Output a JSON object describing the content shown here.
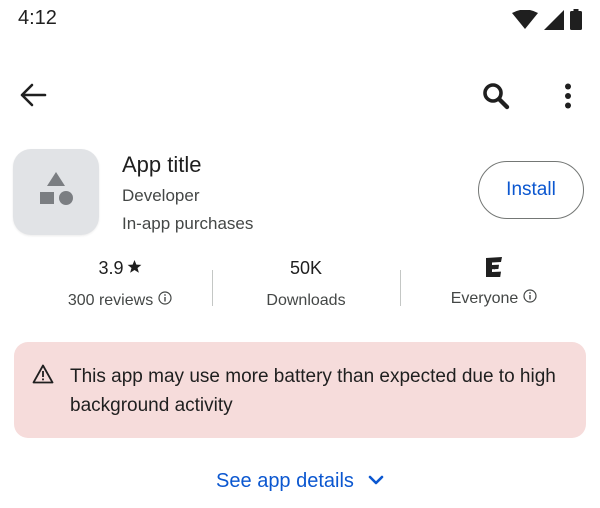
{
  "status_bar": {
    "time": "4:12",
    "icons": [
      "wifi-icon",
      "cellular-signal-icon",
      "battery-icon"
    ]
  },
  "toolbar": {
    "icons": [
      "back-arrow-icon",
      "search-icon",
      "more-vertical-icon"
    ]
  },
  "app": {
    "title": "App title",
    "developer": "Developer",
    "in_app_purchases": "In-app purchases",
    "icon": "shapes-placeholder-icon",
    "install_label": "Install"
  },
  "stats": {
    "rating": {
      "value": "3.9",
      "label": "300 reviews"
    },
    "downloads": {
      "value": "50K",
      "label": "Downloads"
    },
    "content_rating": {
      "badge": "E",
      "label": "Everyone"
    }
  },
  "warning": {
    "icon": "warning-triangle-icon",
    "text": "This app may use more battery than expected due to high background activity"
  },
  "details_link": {
    "label": "See app details",
    "icon": "chevron-down-icon"
  },
  "colors": {
    "accent": "#0b57d0",
    "warning_background": "#f6dcdb",
    "app_icon_background": "#e1e3e6",
    "text_primary": "#1f1f1f",
    "text_secondary": "#444746"
  }
}
